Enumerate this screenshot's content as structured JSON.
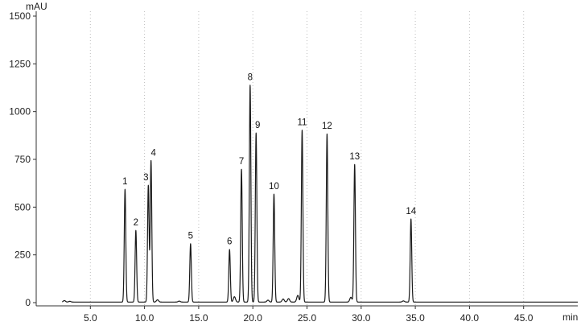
{
  "chart_data": {
    "type": "line",
    "y_unit_label": "mAU",
    "x_unit_label": "min",
    "xlim": [
      0,
      50
    ],
    "ylim": [
      0,
      1500
    ],
    "x_ticks": [
      5.0,
      10.0,
      15.0,
      20.0,
      25.0,
      30.0,
      35.0,
      40.0,
      45.0
    ],
    "x_tick_labels": [
      "5.0",
      "10.0",
      "15.0",
      "20.0",
      "25.0",
      "30.0",
      "35.0",
      "40.0",
      "45.0"
    ],
    "y_ticks": [
      0,
      250,
      500,
      750,
      1000,
      1250,
      1500
    ],
    "y_tick_labels": [
      "0",
      "250",
      "500",
      "750",
      "1000",
      "1250",
      "1500"
    ],
    "grid": "vertical-dotted",
    "line_color": "#1a1a1a",
    "grid_color": "#bdbdbd",
    "peaks": [
      {
        "label": "1",
        "rt": 8.2,
        "height": 590
      },
      {
        "label": "2",
        "rt": 9.2,
        "height": 375
      },
      {
        "label": "3",
        "rt": 10.35,
        "height": 610
      },
      {
        "label": "4",
        "rt": 10.6,
        "height": 740
      },
      {
        "label": "5",
        "rt": 14.25,
        "height": 305
      },
      {
        "label": "6",
        "rt": 17.85,
        "height": 275
      },
      {
        "label": "7",
        "rt": 18.95,
        "height": 695
      },
      {
        "label": "8",
        "rt": 19.75,
        "height": 1135
      },
      {
        "label": "9",
        "rt": 20.3,
        "height": 885
      },
      {
        "label": "10",
        "rt": 21.95,
        "height": 565
      },
      {
        "label": "11",
        "rt": 24.55,
        "height": 900
      },
      {
        "label": "12",
        "rt": 26.85,
        "height": 880
      },
      {
        "label": "13",
        "rt": 29.4,
        "height": 720
      },
      {
        "label": "14",
        "rt": 34.6,
        "height": 435
      }
    ]
  }
}
